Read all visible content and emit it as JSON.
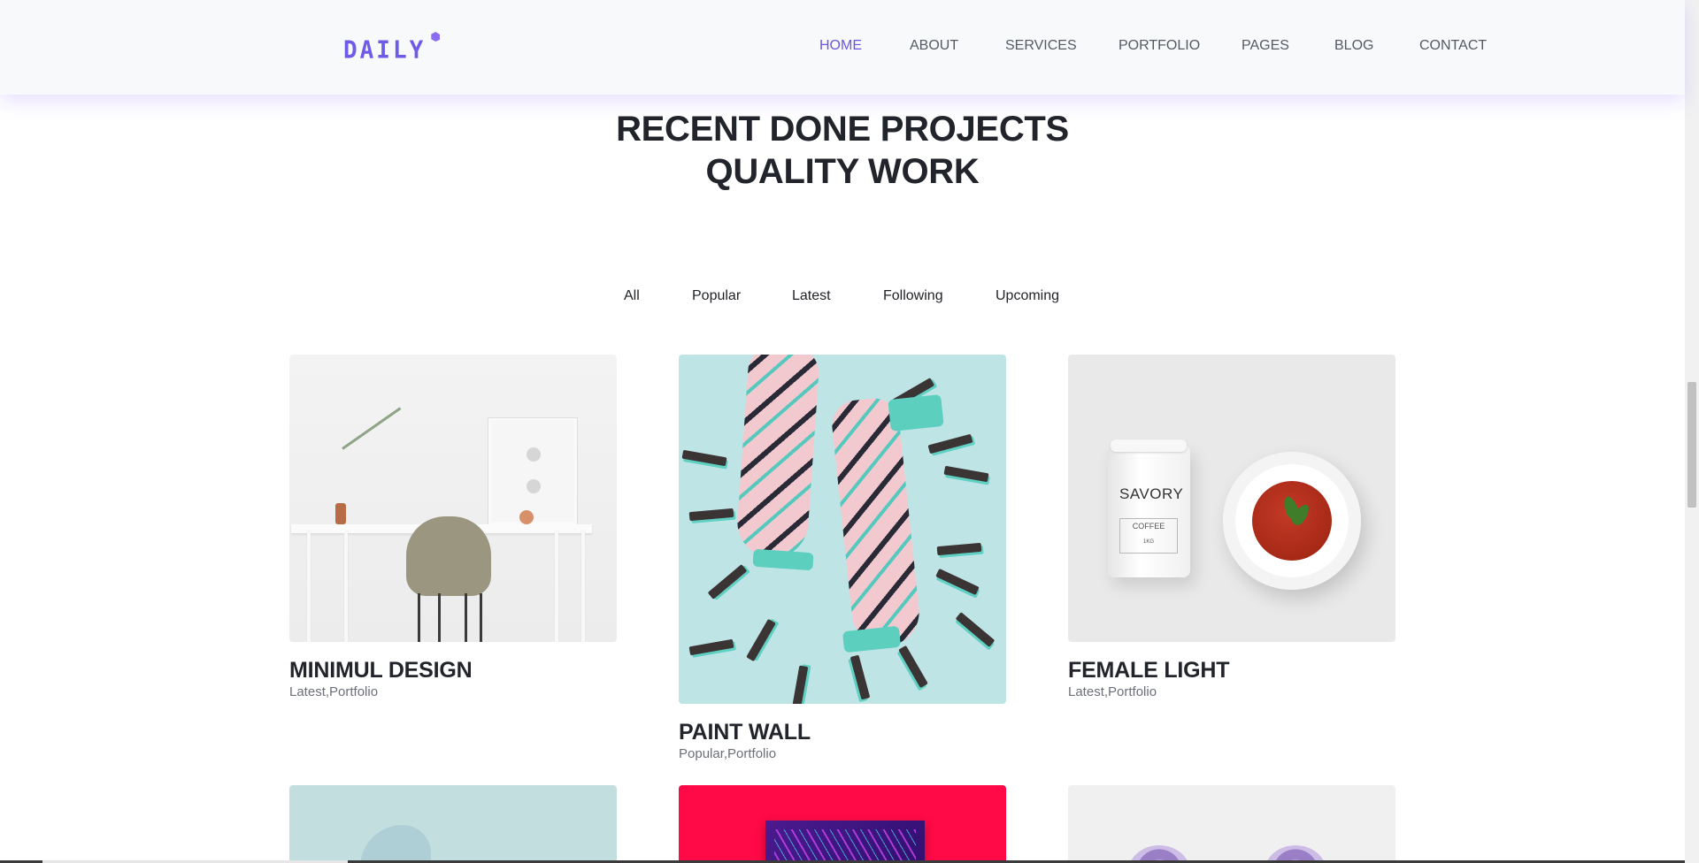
{
  "brand": {
    "logo_text": "DAILY",
    "accent_color": "#6c55e0"
  },
  "nav": {
    "items": [
      {
        "label": "HOME",
        "active": true
      },
      {
        "label": "ABOUT",
        "active": false
      },
      {
        "label": "SERVICES",
        "active": false
      },
      {
        "label": "PORTFOLIO",
        "active": false
      },
      {
        "label": "PAGES",
        "active": false
      },
      {
        "label": "BLOG",
        "active": false
      },
      {
        "label": "CONTACT",
        "active": false
      }
    ]
  },
  "section": {
    "title_line1": "RECENT DONE PROJECTS",
    "title_line2": "QUALITY WORK"
  },
  "filters": [
    "All",
    "Popular",
    "Latest",
    "Following",
    "Upcoming"
  ],
  "projects": [
    {
      "title": "MINIMUL DESIGN",
      "tags": "Latest,Portfolio",
      "image": "minimal-desk-image"
    },
    {
      "title": "PAINT WALL",
      "tags": "Popular,Portfolio",
      "image": "patterned-socks-image"
    },
    {
      "title": "FEMALE LIGHT",
      "tags": "Latest,Portfolio",
      "image": "coffee-soup-image"
    }
  ],
  "projects_row2": [
    {
      "image": "teal-sculpture-image"
    },
    {
      "image": "red-poster-image"
    },
    {
      "image": "flowers-image"
    }
  ],
  "image_text": {
    "can_brand": "SAVORY",
    "can_label": "COFFEE",
    "can_sub": "1KG"
  }
}
